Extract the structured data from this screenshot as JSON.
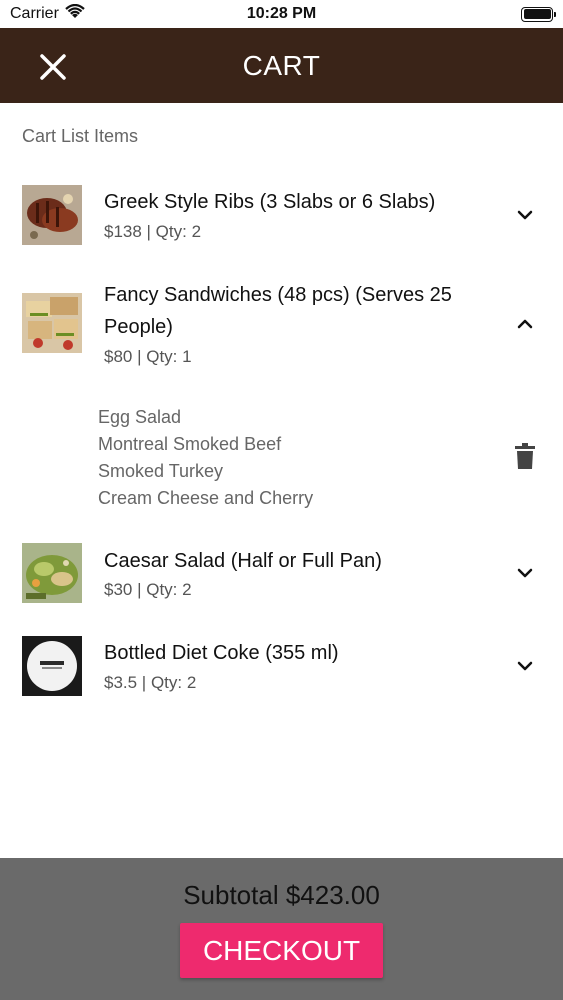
{
  "status_bar": {
    "carrier": "Carrier",
    "time": "10:28 PM"
  },
  "header": {
    "title": "CART",
    "close_icon": "close-icon"
  },
  "section_label": "Cart List Items",
  "items": [
    {
      "title": "Greek Style Ribs (3 Slabs or 6 Slabs)",
      "meta": "$138 | Qty: 2",
      "expanded": false
    },
    {
      "title": "Fancy Sandwiches (48 pcs) (Serves 25 People)",
      "meta": "$80 | Qty: 1",
      "expanded": true,
      "options": [
        "Egg Salad",
        "Montreal Smoked Beef",
        "Smoked Turkey",
        "Cream Cheese and Cherry"
      ]
    },
    {
      "title": "Caesar Salad (Half or Full Pan)",
      "meta": "$30 | Qty: 2",
      "expanded": false
    },
    {
      "title": "Bottled Diet Coke (355 ml)",
      "meta": "$3.5 | Qty: 2",
      "expanded": false
    }
  ],
  "footer": {
    "subtotal": "Subtotal $423.00",
    "checkout_label": "CHECKOUT"
  },
  "colors": {
    "header_bg": "#3a2418",
    "footer_bg": "#6a6a6a",
    "checkout": "#ee2a6e"
  }
}
